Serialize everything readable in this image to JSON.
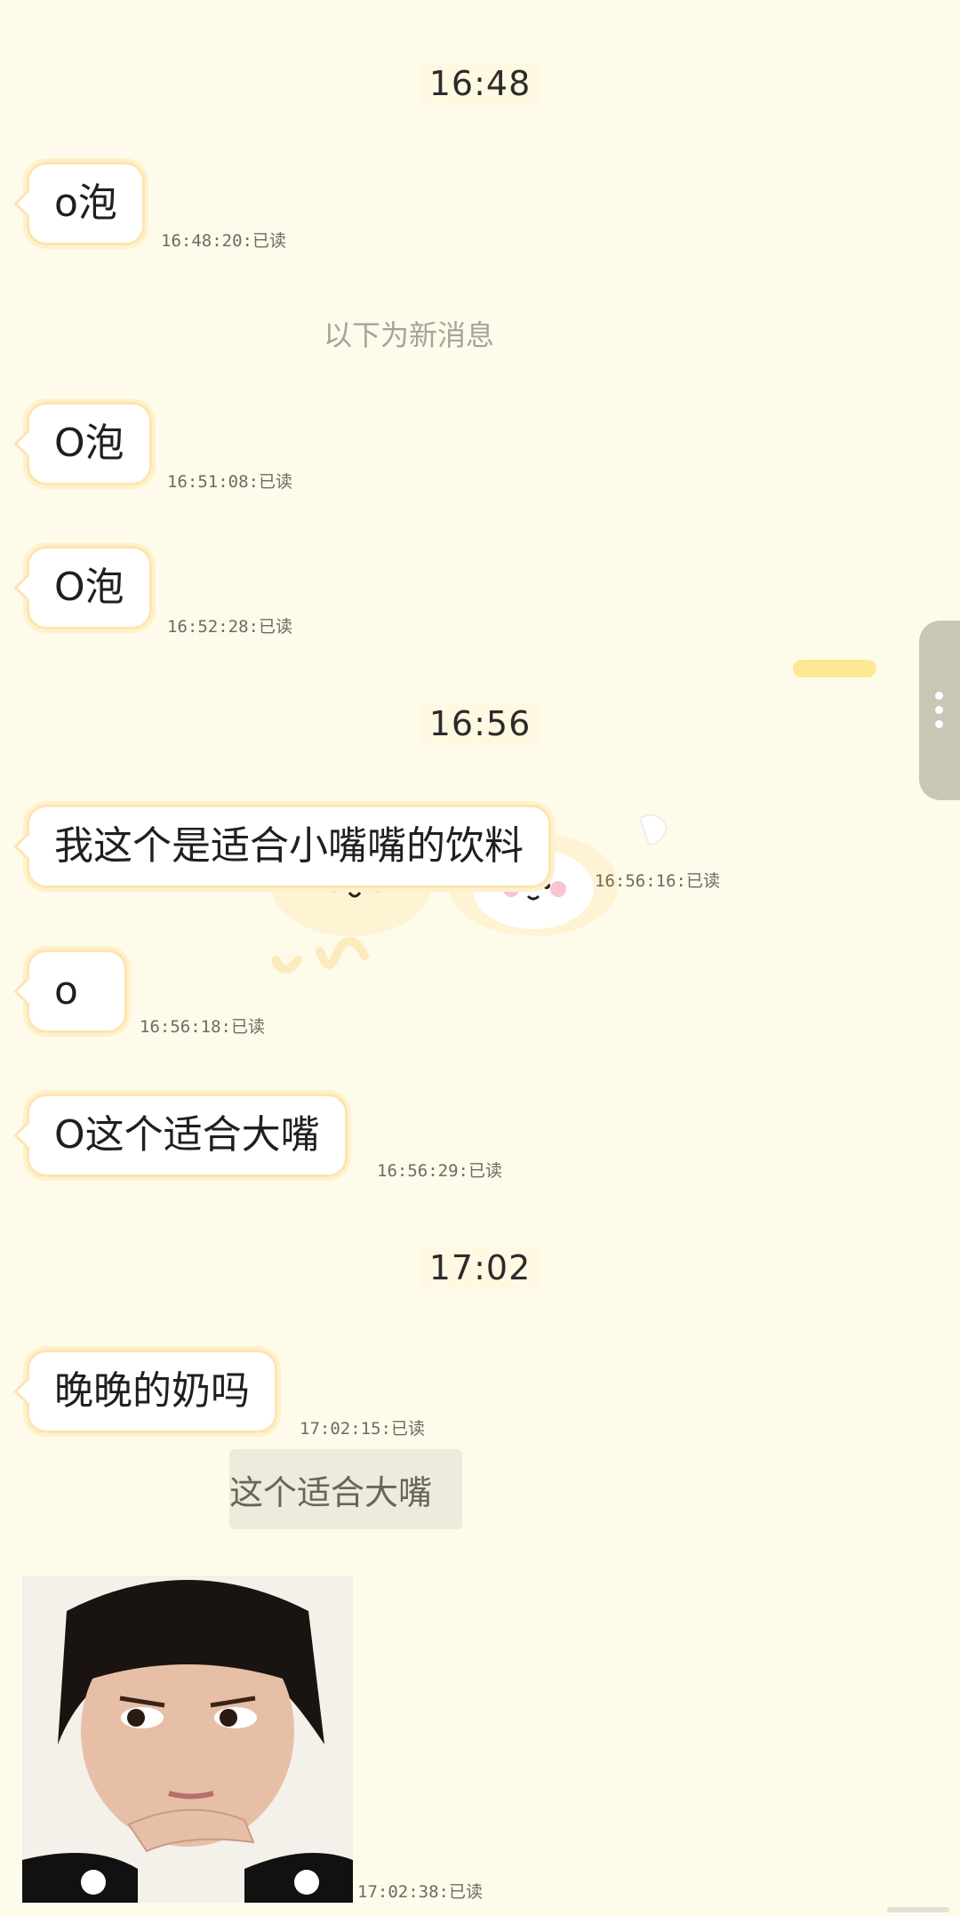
{
  "time_headers": [
    "16:48",
    "16:56",
    "17:02"
  ],
  "new_messages_divider": "以下为新消息",
  "messages": [
    {
      "text": "o泡",
      "meta": "16:48:20:已读"
    },
    {
      "text": "O泡",
      "meta": "16:51:08:已读"
    },
    {
      "text": "O泡",
      "meta": "16:52:28:已读"
    },
    {
      "text": "我这个是适合小嘴嘴的饮料",
      "meta": "16:56:16:已读"
    },
    {
      "text": "o",
      "meta": "16:56:18:已读"
    },
    {
      "text": "O这个适合大嘴",
      "meta": "16:56:29:已读"
    },
    {
      "text": "晚晚的奶吗",
      "meta": "17:02:15:已读"
    }
  ],
  "quoted_reply": "这个适合大嘴",
  "image_message": {
    "icon": "photo-thinking-child",
    "meta": "17:02:38:已读"
  },
  "sticker": {
    "icon": "cute-animal-sticker-icon"
  },
  "side_panel": {
    "icon": "more-vertical-icon"
  },
  "colors": {
    "background": "#fffbeb",
    "bubble_border": "#fde5b0"
  }
}
